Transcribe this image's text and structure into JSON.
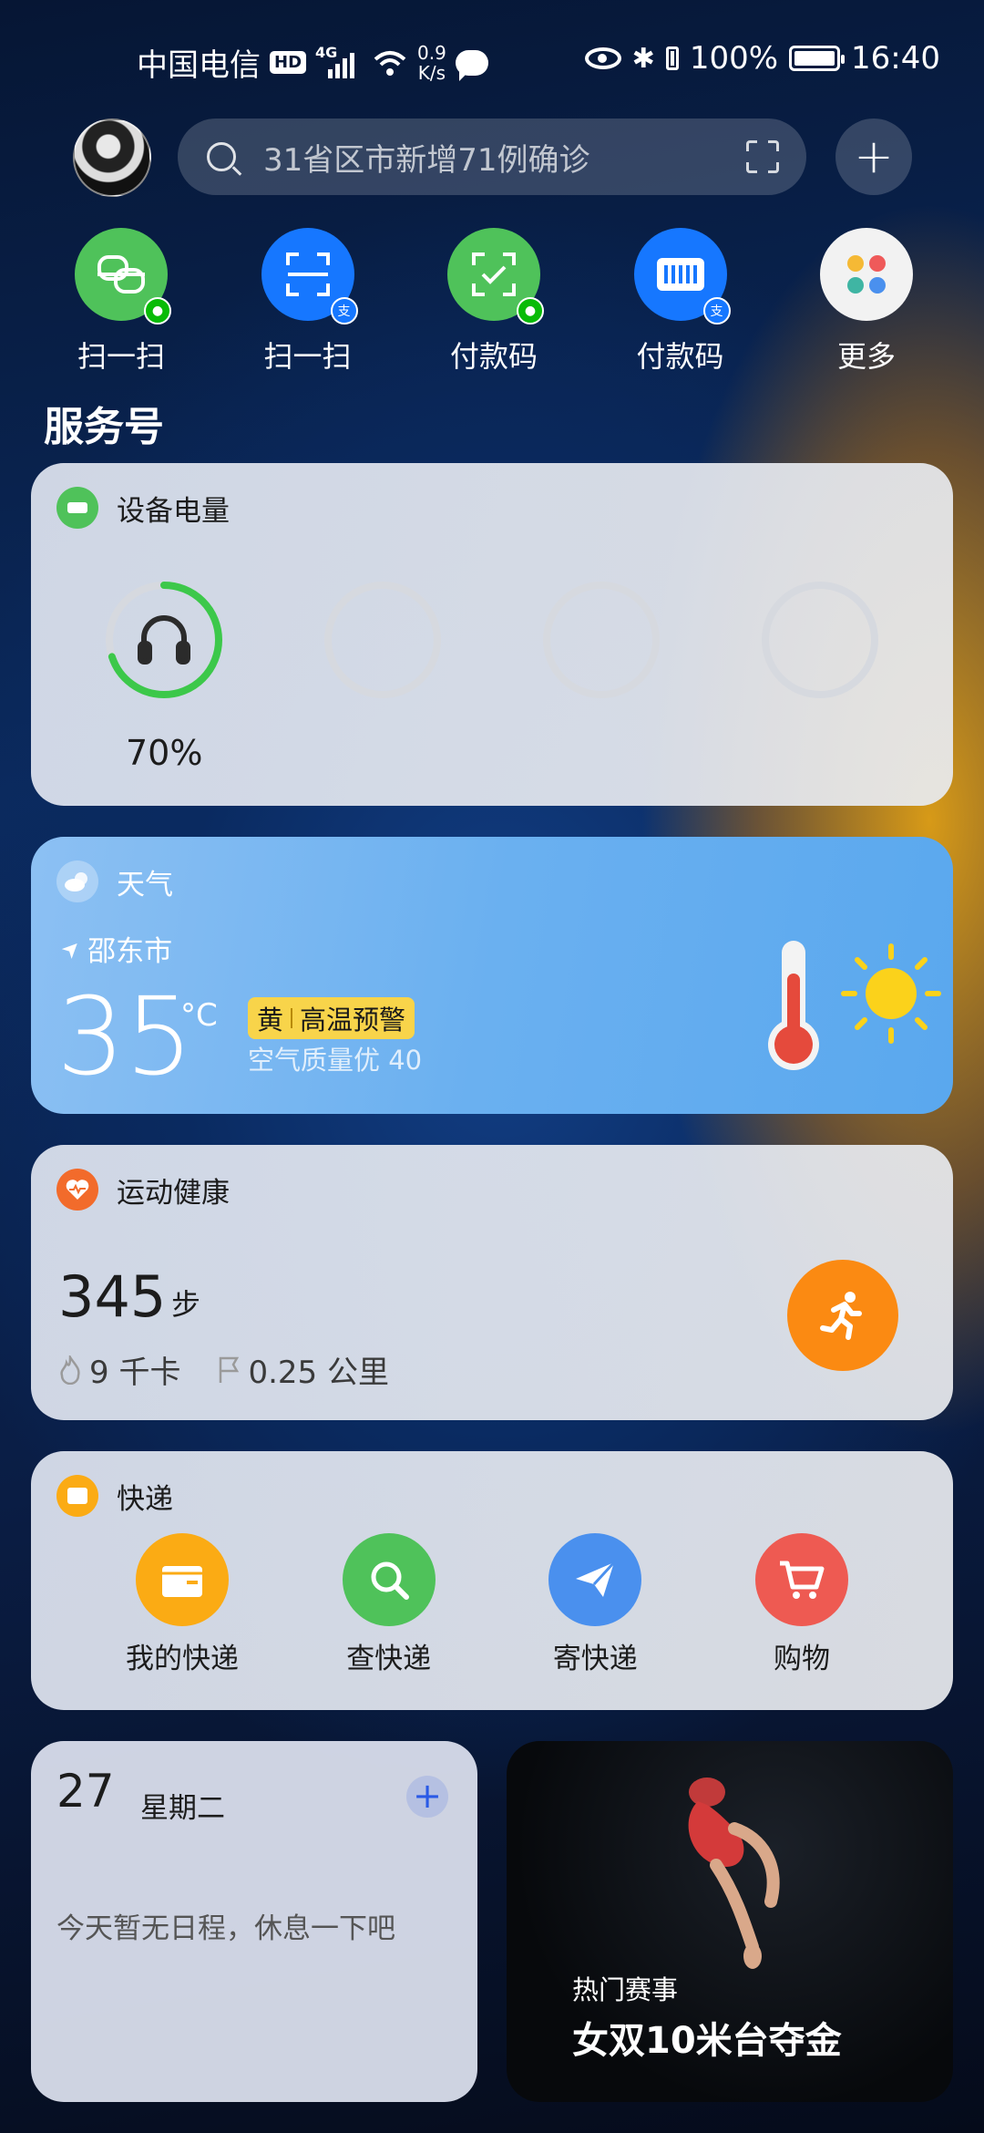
{
  "status_bar": {
    "carrier": "中国电信",
    "hd": "HD",
    "network": "4G",
    "speed_value": "0.9",
    "speed_unit": "K/s",
    "battery_percent": "100%",
    "time": "16:40"
  },
  "top_bar": {
    "search_placeholder": "31省区市新增71例确诊",
    "add_label": "+"
  },
  "quick_actions": [
    {
      "label": "扫一扫",
      "icon": "wechat-scan-icon",
      "badge": "wechat"
    },
    {
      "label": "扫一扫",
      "icon": "alipay-scan-icon",
      "badge": "alipay"
    },
    {
      "label": "付款码",
      "icon": "wechat-pay-code-icon",
      "badge": "wechat"
    },
    {
      "label": "付款码",
      "icon": "alipay-pay-code-icon",
      "badge": "alipay"
    },
    {
      "label": "更多",
      "icon": "more-apps-icon"
    }
  ],
  "section_title": "服务号",
  "battery_card": {
    "title": "设备电量",
    "devices": [
      {
        "icon": "headphones-icon",
        "percent_label": "70%",
        "level": 0.7
      },
      {
        "level": 0
      },
      {
        "level": 0
      },
      {
        "level": 0
      }
    ]
  },
  "weather_card": {
    "title": "天气",
    "location": "邵东市",
    "temperature": "35",
    "unit": "°C",
    "warning_level": "黄",
    "warning_text": "高温预警",
    "air_quality": "空气质量优 40"
  },
  "health_card": {
    "title": "运动健康",
    "steps": "345",
    "steps_unit": "步",
    "calories": "9 千卡",
    "distance": "0.25 公里"
  },
  "express_card": {
    "title": "快递",
    "items": [
      {
        "label": "我的快递",
        "icon": "package-icon",
        "color": "#fbab14"
      },
      {
        "label": "查快递",
        "icon": "search-package-icon",
        "color": "#4fc25a"
      },
      {
        "label": "寄快递",
        "icon": "send-plane-icon",
        "color": "#4a90ee"
      },
      {
        "label": "购物",
        "icon": "shopping-cart-icon",
        "color": "#ee5a52"
      }
    ]
  },
  "calendar_card": {
    "day": "27",
    "weekday": "星期二",
    "empty_text": "今天暂无日程，休息一下吧"
  },
  "hot_card": {
    "subtitle": "热门赛事",
    "title": "女双10米台夺金"
  },
  "colors": {
    "accent_green": "#4fc25a",
    "accent_blue": "#1677ff",
    "orange": "#fb8a12",
    "warning_yellow": "#f8d44a"
  }
}
